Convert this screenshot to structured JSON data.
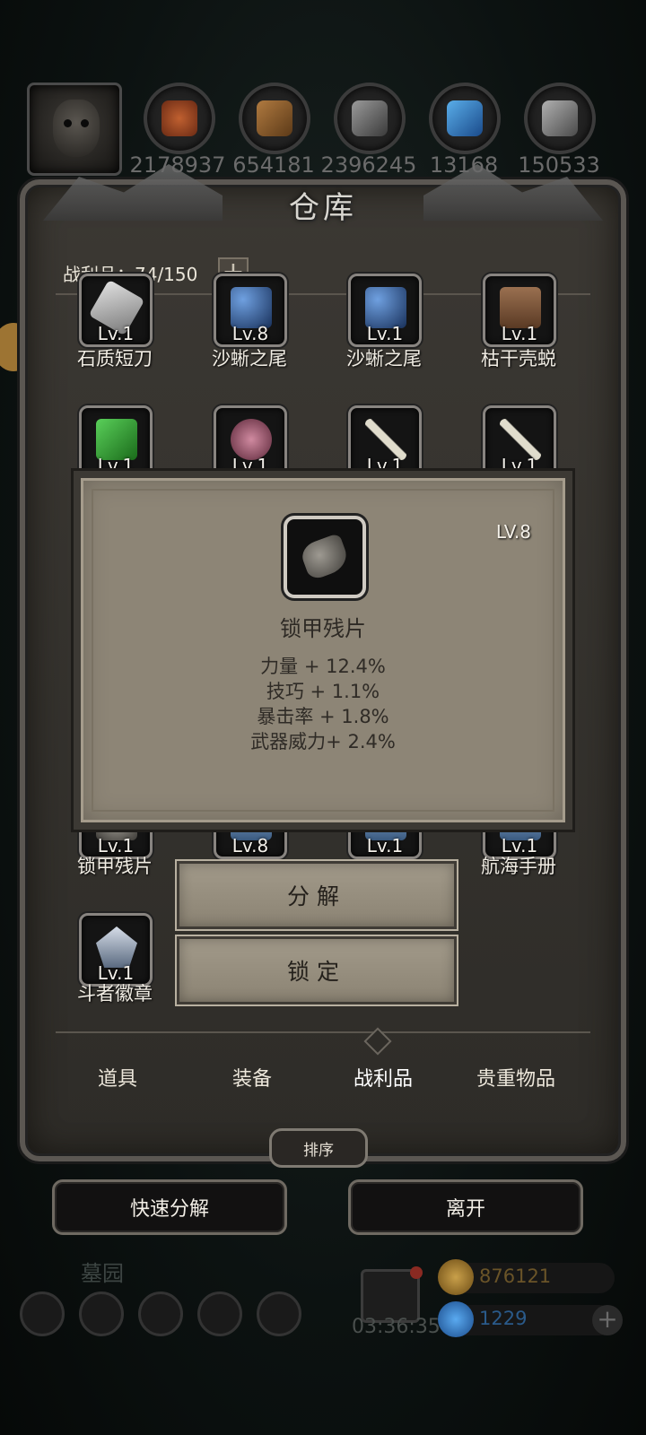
{
  "resources": [
    {
      "icon": "meat-icon",
      "value": "2178937",
      "color": "#a14a28"
    },
    {
      "icon": "wood-plank-icon",
      "value": "654181",
      "color": "#8a5a2e"
    },
    {
      "icon": "iron-ingot-icon",
      "value": "2396245",
      "color": "#6e6e6e"
    },
    {
      "icon": "blue-crystal-icon",
      "value": "13168",
      "color": "#2f7fc4"
    },
    {
      "icon": "silver-ingot-icon",
      "value": "150533",
      "color": "#8a8a8a"
    }
  ],
  "panel": {
    "title": "仓库",
    "loot_label": "战利品：74/150",
    "add_label": "+"
  },
  "items": [
    {
      "level": "Lv.1",
      "name": "石质短刀",
      "color": "#c9c9c9"
    },
    {
      "level": "Lv.8",
      "name": "沙蜥之尾",
      "color": "#3a6fb0"
    },
    {
      "level": "Lv.1",
      "name": "沙蜥之尾",
      "color": "#3a6fb0"
    },
    {
      "level": "Lv.1",
      "name": "枯干壳蜕",
      "color": "#8a6244"
    },
    {
      "level": "Lv.1",
      "name": "",
      "color": "#2e8a2e"
    },
    {
      "level": "Lv.1",
      "name": "",
      "color": "#a86078"
    },
    {
      "level": "Lv.1",
      "name": "",
      "color": "#d8d4c6"
    },
    {
      "level": "Lv.1",
      "name": "",
      "color": "#d8d4c6"
    },
    {
      "level": "Lv.1",
      "name": "锁甲残片",
      "color": "#8b8780"
    },
    {
      "level": "Lv.8",
      "name": "",
      "color": "#7aa0c8"
    },
    {
      "level": "Lv.1",
      "name": "",
      "color": "#7aa0c8"
    },
    {
      "level": "Lv.1",
      "name": "航海手册",
      "color": "#7aa0c8"
    },
    {
      "level": "Lv.1",
      "name": "斗者徽章",
      "color": "#aab6c8"
    }
  ],
  "popup": {
    "level": "LV.8",
    "name": "锁甲残片",
    "stats": [
      "力量 + 12.4%",
      "技巧 + 1.1%",
      "暴击率 + 1.8%",
      "武器威力+ 2.4%"
    ]
  },
  "actions": {
    "decompose": "分解",
    "lock": "锁定"
  },
  "tabs": [
    "道具",
    "装备",
    "战利品",
    "贵重物品"
  ],
  "active_tab": "战利品",
  "sort_label": "排序",
  "bottom_buttons": {
    "quick_decompose": "快速分解",
    "leave": "离开"
  },
  "hud": {
    "area_name": "墓园",
    "timer": "03:36:35",
    "gold": "876121",
    "gems": "1229",
    "plus": "+"
  }
}
